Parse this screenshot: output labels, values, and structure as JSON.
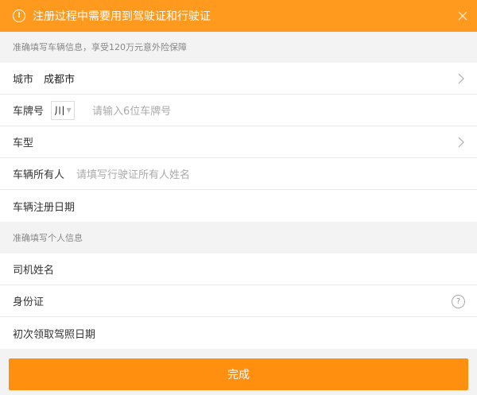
{
  "banner": {
    "icon": "warning-icon",
    "text": "注册过程中需要用到驾驶证和行驶证",
    "close_icon": "close-icon",
    "color": "#ff9a1f"
  },
  "vehicle_section": {
    "header": "准确填写车辆信息，享受120万元意外险保障",
    "city": {
      "label": "城市",
      "value": "成都市"
    },
    "plate": {
      "label": "车牌号",
      "province": "川",
      "placeholder": "请输入6位车牌号"
    },
    "model": {
      "label": "车型"
    },
    "owner": {
      "label": "车辆所有人",
      "placeholder": "请填写行驶证所有人姓名"
    },
    "reg_date": {
      "label": "车辆注册日期"
    }
  },
  "personal_section": {
    "header": "准确填写个人信息",
    "driver_name": {
      "label": "司机姓名"
    },
    "id_card": {
      "label": "身份证",
      "help_icon": "question-circle-icon"
    },
    "license_date": {
      "label": "初次领取驾照日期"
    }
  },
  "footer": {
    "done_label": "完成",
    "color": "#ff8f0f"
  }
}
